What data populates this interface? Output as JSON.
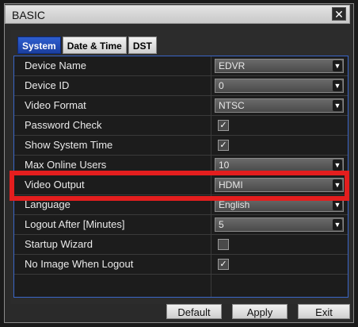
{
  "window": {
    "title": "BASIC",
    "close_icon": "close-icon"
  },
  "tabs": [
    {
      "label": "System",
      "active": true
    },
    {
      "label": "Date & Time",
      "active": false
    },
    {
      "label": "DST",
      "active": false
    }
  ],
  "rows": [
    {
      "label": "Device Name",
      "type": "select",
      "value": "EDVR"
    },
    {
      "label": "Device ID",
      "type": "select",
      "value": "0"
    },
    {
      "label": "Video Format",
      "type": "select",
      "value": "NTSC"
    },
    {
      "label": "Password Check",
      "type": "checkbox",
      "checked": true
    },
    {
      "label": "Show System Time",
      "type": "checkbox",
      "checked": true
    },
    {
      "label": "Max Online Users",
      "type": "select",
      "value": "10"
    },
    {
      "label": "Video Output",
      "type": "select",
      "value": "HDMI"
    },
    {
      "label": "Language",
      "type": "select",
      "value": "English"
    },
    {
      "label": "Logout After [Minutes]",
      "type": "select",
      "value": "5"
    },
    {
      "label": "Startup Wizard",
      "type": "checkbox",
      "checked": false
    },
    {
      "label": "No Image When Logout",
      "type": "checkbox",
      "checked": true
    }
  ],
  "footer": {
    "default_label": "Default",
    "apply_label": "Apply",
    "exit_label": "Exit"
  },
  "colors": {
    "highlight": "#e41e1e",
    "tab_active": "#1b3fa0",
    "grid_border": "#3a66c8"
  }
}
